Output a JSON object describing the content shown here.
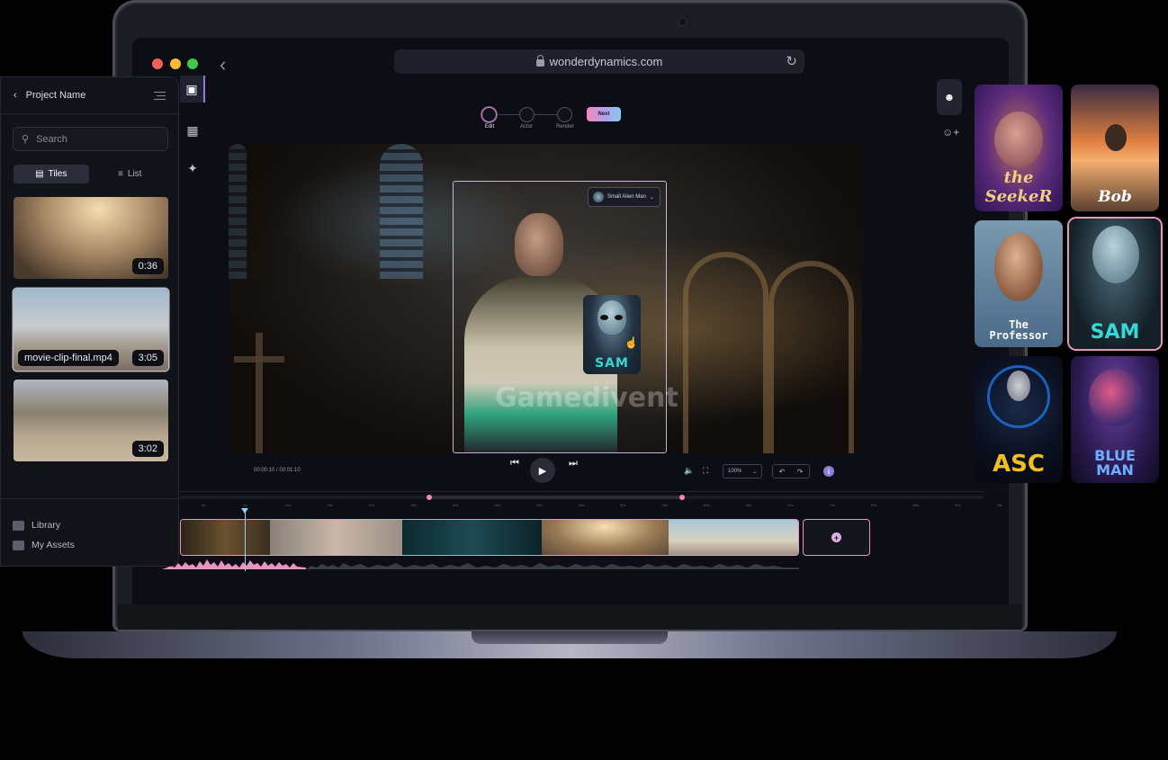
{
  "browser": {
    "url": "wonderdynamics.com"
  },
  "stepper": {
    "steps": [
      {
        "label": "Edit"
      },
      {
        "label": "Actor"
      },
      {
        "label": "Render"
      }
    ],
    "next_label": "Next"
  },
  "viewer": {
    "character_dropdown": "Small Alien Man",
    "overlay_character": "SAM",
    "watermark": "Gamedivent"
  },
  "playback": {
    "timecode": "00:00:10 / 00:01:10",
    "zoom": "100%"
  },
  "timeline": {
    "ticks": [
      "0s",
      "5s",
      "10s",
      "15s",
      "20s",
      "25s",
      "30s",
      "35s",
      "40s",
      "45s",
      "50s",
      "55s",
      "60s",
      "65s",
      "70s",
      "75s",
      "80s",
      "85s",
      "90s",
      "95s"
    ]
  },
  "panel": {
    "project_name": "Project Name",
    "search_placeholder": "Search",
    "view_tiles": "Tiles",
    "view_list": "List",
    "clips": [
      {
        "duration": "0:36",
        "filename": ""
      },
      {
        "duration": "3:05",
        "filename": "movie-clip-final.mp4"
      },
      {
        "duration": "3:02",
        "filename": ""
      }
    ],
    "footer": {
      "library": "Library",
      "my_assets": "My Assets"
    }
  },
  "characters": [
    {
      "name": "the SeekeR",
      "selected": false
    },
    {
      "name": "Bob",
      "selected": false
    },
    {
      "name": "The Professor",
      "selected": false
    },
    {
      "name": "SAM",
      "selected": true
    },
    {
      "name": "ASC",
      "selected": false
    },
    {
      "name": "BLUE MAN",
      "selected": false
    }
  ],
  "colors": {
    "accent_pink": "#e894be",
    "accent_purple": "#8a7de0",
    "playhead": "#8fd6f5"
  }
}
